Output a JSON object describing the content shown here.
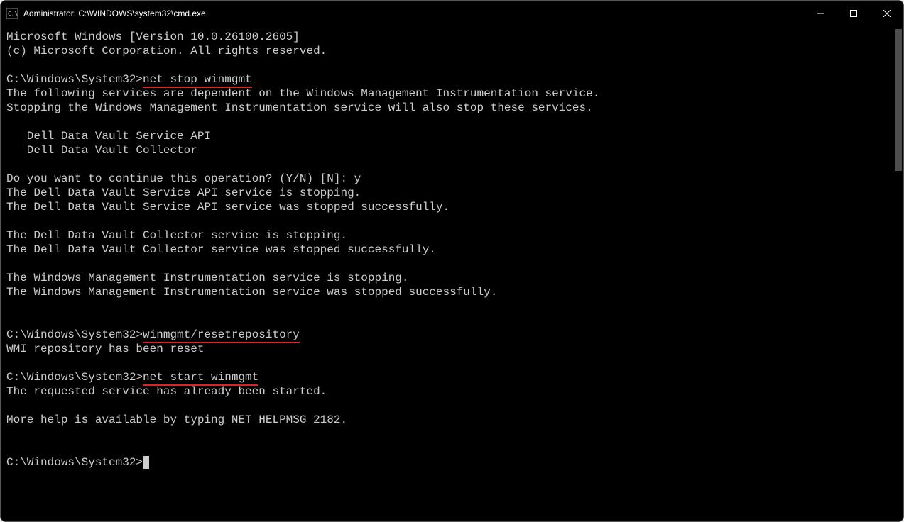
{
  "window": {
    "title": "Administrator: C:\\WINDOWS\\system32\\cmd.exe"
  },
  "terminal": {
    "header_line1": "Microsoft Windows [Version 10.0.26100.2605]",
    "header_line2": "(c) Microsoft Corporation. All rights reserved.",
    "prompt": "C:\\Windows\\System32>",
    "cmd1": "net stop winmgmt",
    "out1_l1": "The following services are dependent on the Windows Management Instrumentation service.",
    "out1_l2": "Stopping the Windows Management Instrumentation service will also stop these services.",
    "out1_l3": "   Dell Data Vault Service API",
    "out1_l4": "   Dell Data Vault Collector",
    "out1_l5": "Do you want to continue this operation? (Y/N) [N]: y",
    "out1_l6": "The Dell Data Vault Service API service is stopping.",
    "out1_l7": "The Dell Data Vault Service API service was stopped successfully.",
    "out1_l8": "The Dell Data Vault Collector service is stopping.",
    "out1_l9": "The Dell Data Vault Collector service was stopped successfully.",
    "out1_l10": "The Windows Management Instrumentation service is stopping.",
    "out1_l11": "The Windows Management Instrumentation service was stopped successfully.",
    "cmd2": "winmgmt/resetrepository",
    "out2_l1": "WMI repository has been reset",
    "cmd3": "net start winmgmt",
    "out3_l1": "The requested service has already been started.",
    "out3_l2": "More help is available by typing NET HELPMSG 2182."
  }
}
